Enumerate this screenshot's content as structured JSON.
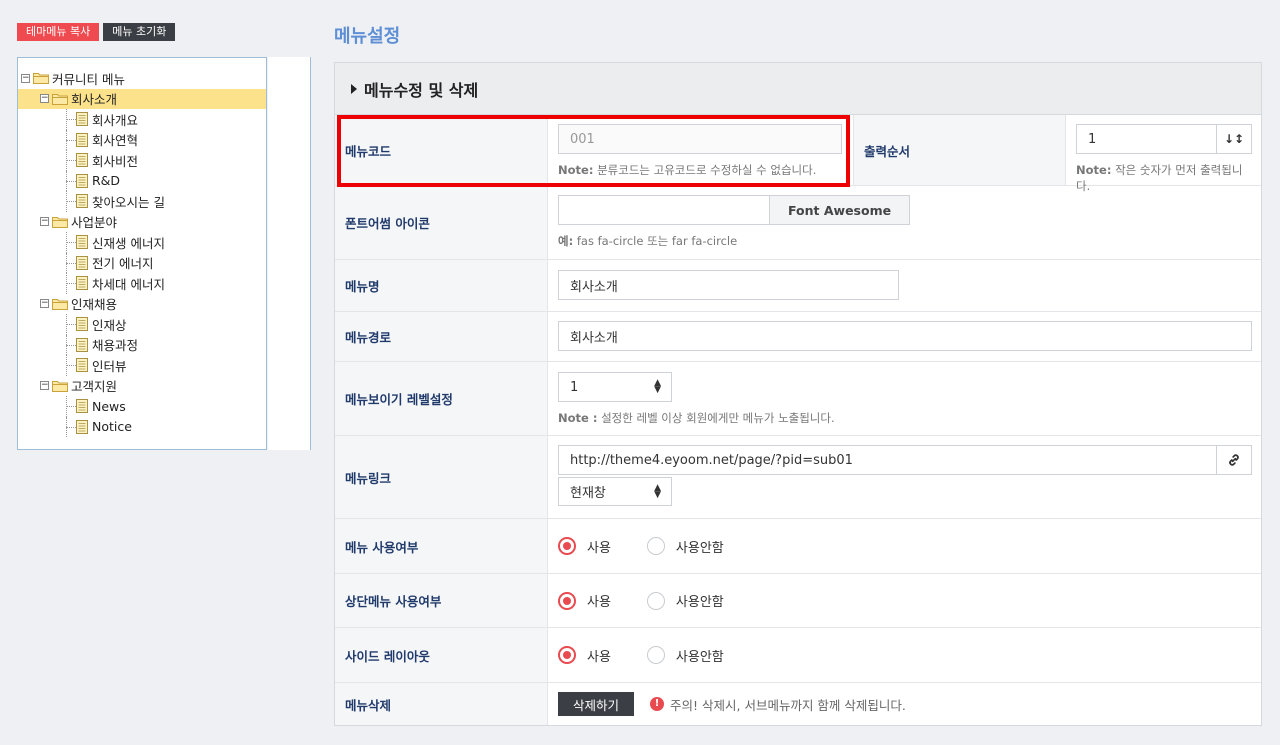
{
  "left": {
    "copy_btn": "테마메뉴 복사",
    "reset_btn": "메뉴 초기화",
    "tree": [
      {
        "label": "커뮤니티 메뉴",
        "level": 0,
        "type": "folder",
        "selected": false
      },
      {
        "label": "회사소개",
        "level": 1,
        "type": "folder",
        "selected": true
      },
      {
        "label": "회사개요",
        "level": 2,
        "type": "doc",
        "selected": false
      },
      {
        "label": "회사연혁",
        "level": 2,
        "type": "doc",
        "selected": false
      },
      {
        "label": "회사비전",
        "level": 2,
        "type": "doc",
        "selected": false
      },
      {
        "label": "R&D",
        "level": 2,
        "type": "doc",
        "selected": false
      },
      {
        "label": "찾아오시는 길",
        "level": 2,
        "type": "doc",
        "selected": false
      },
      {
        "label": "사업분야",
        "level": 1,
        "type": "folder",
        "selected": false
      },
      {
        "label": "신재생 에너지",
        "level": 2,
        "type": "doc",
        "selected": false
      },
      {
        "label": "전기 에너지",
        "level": 2,
        "type": "doc",
        "selected": false
      },
      {
        "label": "차세대 에너지",
        "level": 2,
        "type": "doc",
        "selected": false
      },
      {
        "label": "인재채용",
        "level": 1,
        "type": "folder",
        "selected": false
      },
      {
        "label": "인재상",
        "level": 2,
        "type": "doc",
        "selected": false
      },
      {
        "label": "채용과정",
        "level": 2,
        "type": "doc",
        "selected": false
      },
      {
        "label": "인터뷰",
        "level": 2,
        "type": "doc",
        "selected": false
      },
      {
        "label": "고객지원",
        "level": 1,
        "type": "folder",
        "selected": false
      },
      {
        "label": "News",
        "level": 2,
        "type": "doc",
        "selected": false
      },
      {
        "label": "Notice",
        "level": 2,
        "type": "doc",
        "selected": false
      }
    ]
  },
  "main": {
    "page_title": "메뉴설정",
    "panel_title": "메뉴수정 및 삭제",
    "menu_code": {
      "label": "메뉴코드",
      "value": "001",
      "note_b": "Note:",
      "note": " 분류코드는 고유코드로 수정하실 수 없습니다."
    },
    "order": {
      "label": "출력순서",
      "value": "1",
      "note_b": "Note:",
      "note": " 작은 숫자가 먼저 출력됩니다."
    },
    "fa_icon": {
      "label": "폰트어썸 아이콘",
      "value": "",
      "button": "Font Awesome",
      "note_b": "예:",
      "note": " fas fa-circle 또는 far fa-circle"
    },
    "menu_name": {
      "label": "메뉴명",
      "value": "회사소개"
    },
    "menu_path": {
      "label": "메뉴경로",
      "value": "회사소개"
    },
    "level": {
      "label": "메뉴보이기 레벨설정",
      "value": "1",
      "note_b": "Note :",
      "note": " 설정한 레벨 이상 회원에게만 메뉴가 노출됩니다."
    },
    "link": {
      "label": "메뉴링크",
      "value": "http://theme4.eyoom.net/page/?pid=sub01",
      "target": "현재창"
    },
    "use": {
      "label": "메뉴 사용여부",
      "yes": "사용",
      "no": "사용안함"
    },
    "top_use": {
      "label": "상단메뉴 사용여부",
      "yes": "사용",
      "no": "사용안함"
    },
    "side": {
      "label": "사이드 레이아웃",
      "yes": "사용",
      "no": "사용안함"
    },
    "delete": {
      "label": "메뉴삭제",
      "button": "삭제하기",
      "warning": "주의! 삭제시, 서브메뉴까지 함께 삭제됩니다."
    }
  },
  "colors": {
    "accent_red": "#ef4a4f",
    "title_blue": "#5e8fd6",
    "label_navy": "#203a6b",
    "selected_row": "#fde28c"
  }
}
